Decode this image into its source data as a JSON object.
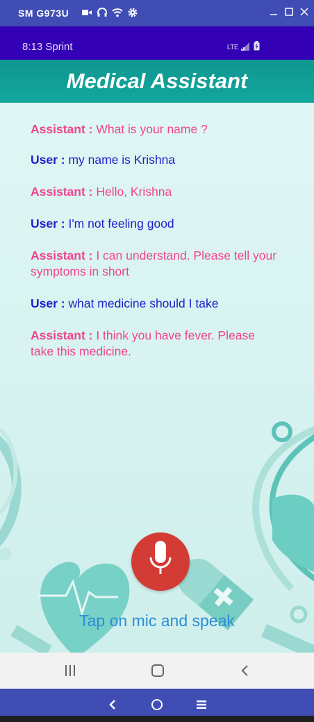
{
  "window": {
    "title": "SM G973U",
    "icons": [
      "video-camera-icon",
      "headphones-icon",
      "wifi-icon",
      "settings-gear-icon"
    ],
    "controls": [
      "minimize-icon",
      "maximize-icon",
      "close-icon"
    ]
  },
  "status_bar": {
    "time_carrier": "8:13 Sprint",
    "network": "LTE",
    "icons": [
      "signal-icon",
      "battery-charging-icon"
    ]
  },
  "app": {
    "title": "Medical Assistant",
    "accent_color": "#13a69d"
  },
  "chat": [
    {
      "speaker": "Assistant :",
      "text": " What is your name ?",
      "role": "assistant"
    },
    {
      "speaker": "User :",
      "text": " my name is Krishna",
      "role": "user"
    },
    {
      "speaker": "Assistant :",
      "text": " Hello, Krishna",
      "role": "assistant"
    },
    {
      "speaker": "User :",
      "text": " I'm not feeling good",
      "role": "user"
    },
    {
      "speaker": "Assistant :",
      "text": " I can understand. Please tell your symptoms in short",
      "role": "assistant"
    },
    {
      "speaker": "User :",
      "text": " what medicine should I take",
      "role": "user"
    },
    {
      "speaker": "Assistant :",
      "text": " I think you have fever. Please take this medicine.",
      "role": "assistant"
    }
  ],
  "mic": {
    "icon": "microphone-icon",
    "color": "#d33b35"
  },
  "hint": "Tap on mic and speak",
  "nav": {
    "icons": [
      "recent-apps-icon",
      "home-icon",
      "back-icon"
    ]
  },
  "emulator_nav": {
    "icons": [
      "emulator-back-icon",
      "emulator-home-icon",
      "emulator-menu-icon"
    ]
  }
}
